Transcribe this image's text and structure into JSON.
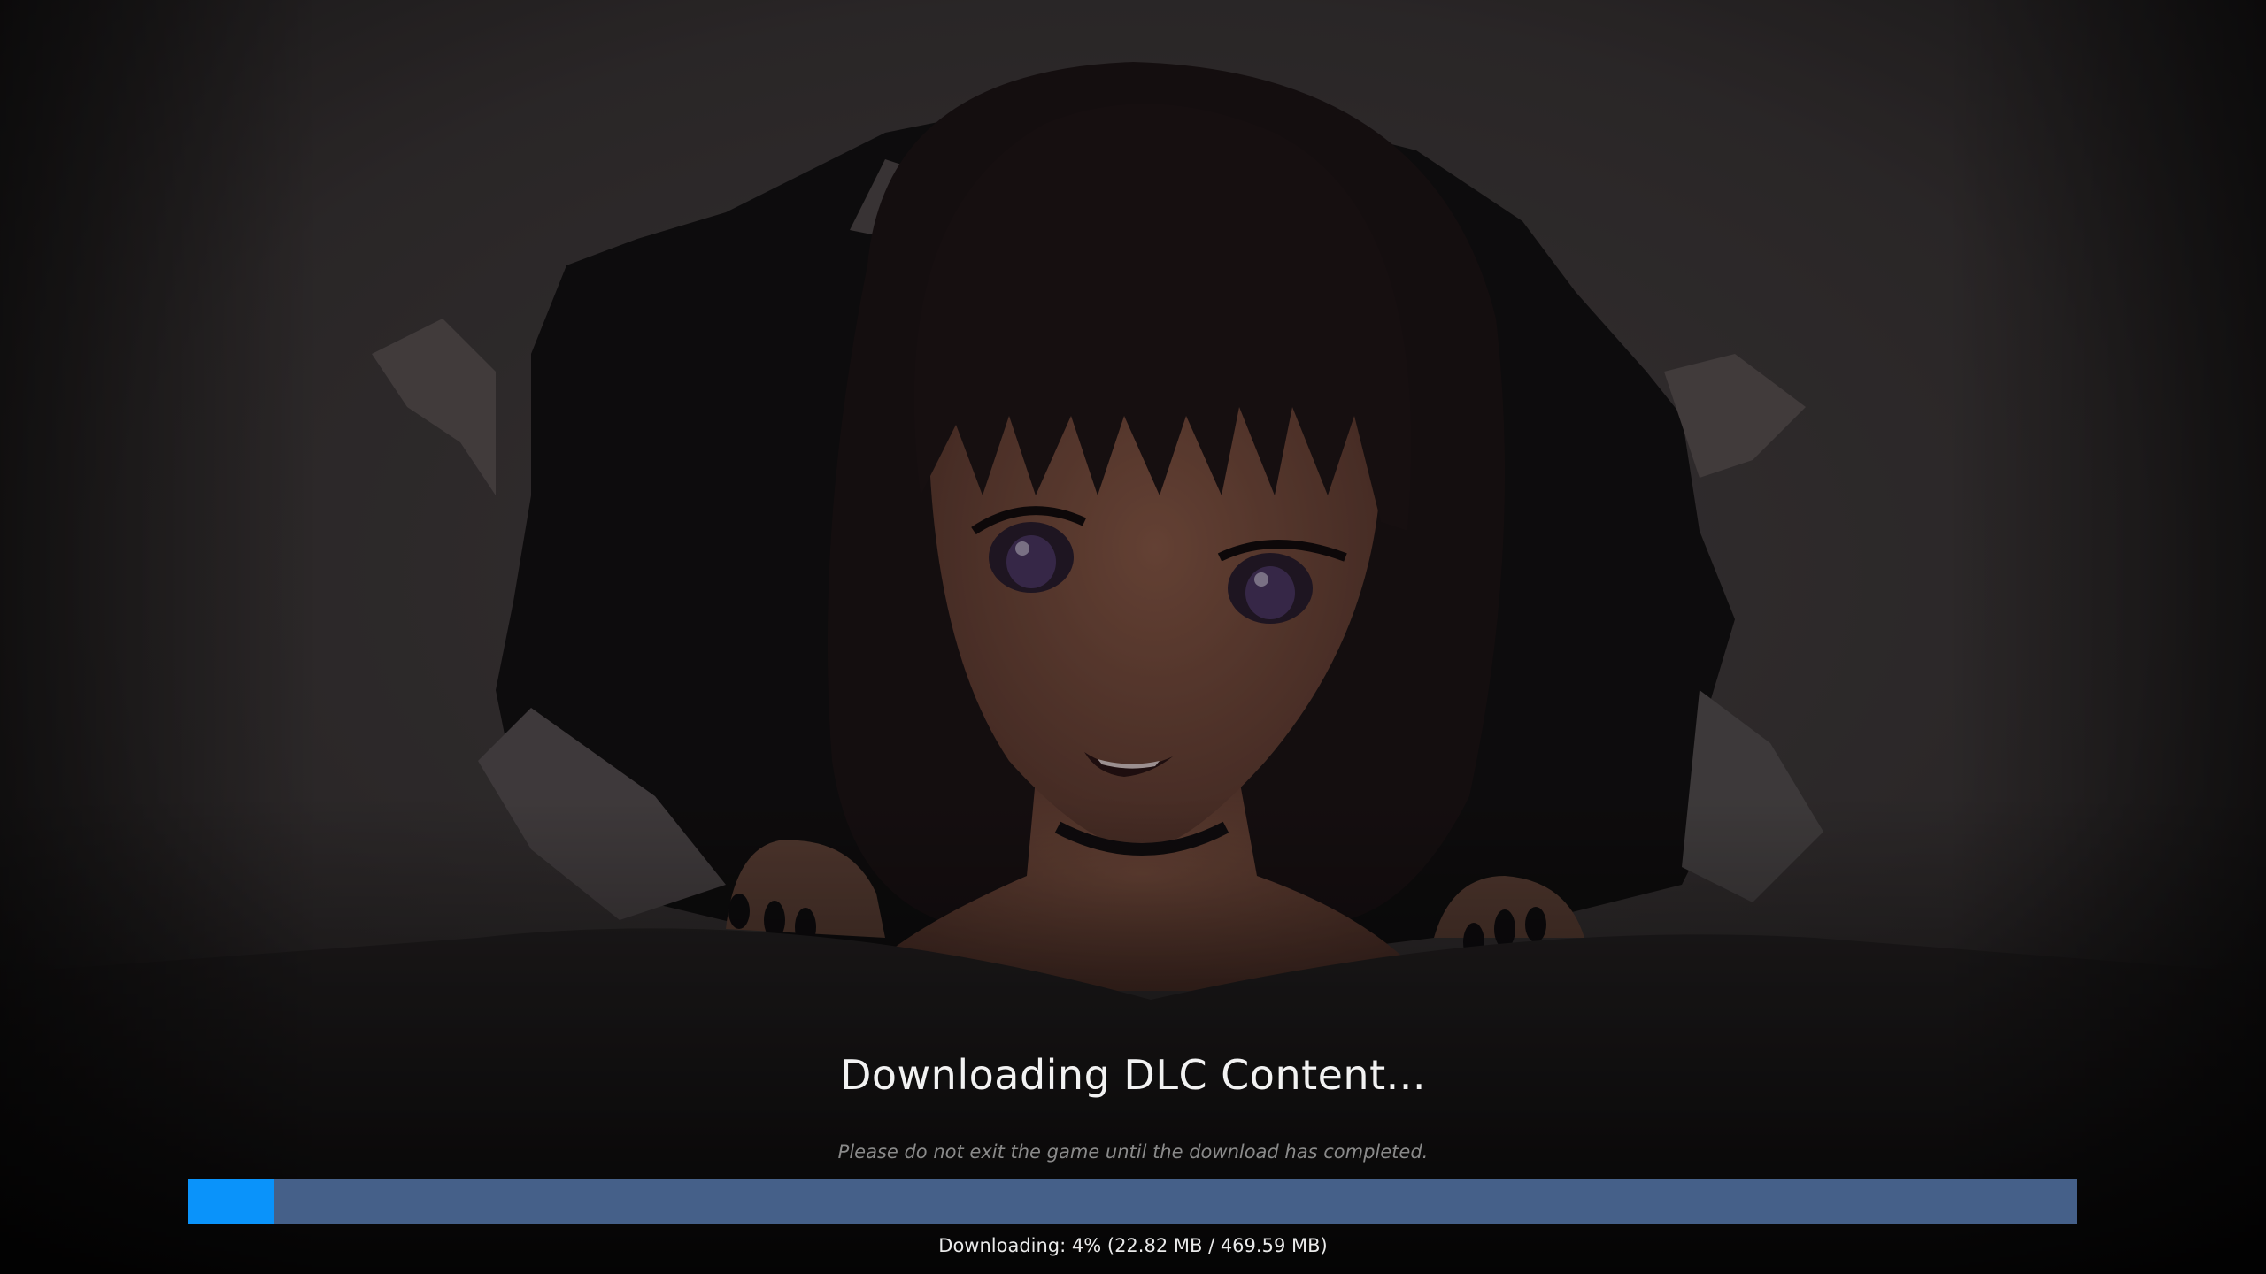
{
  "download": {
    "title": "Downloading DLC Content...",
    "notice": "Please do not exit the game until the download has completed.",
    "progress_fraction": 0.04,
    "status_text": "Downloading: 4% (22.82 MB / 469.59 MB)"
  },
  "colors": {
    "progress_fill": "#0a93fa",
    "progress_track": "#456089",
    "background_dim": "#2b2a2b"
  },
  "background": {
    "image": "anime-girl-peeking-through-torn-wall"
  }
}
